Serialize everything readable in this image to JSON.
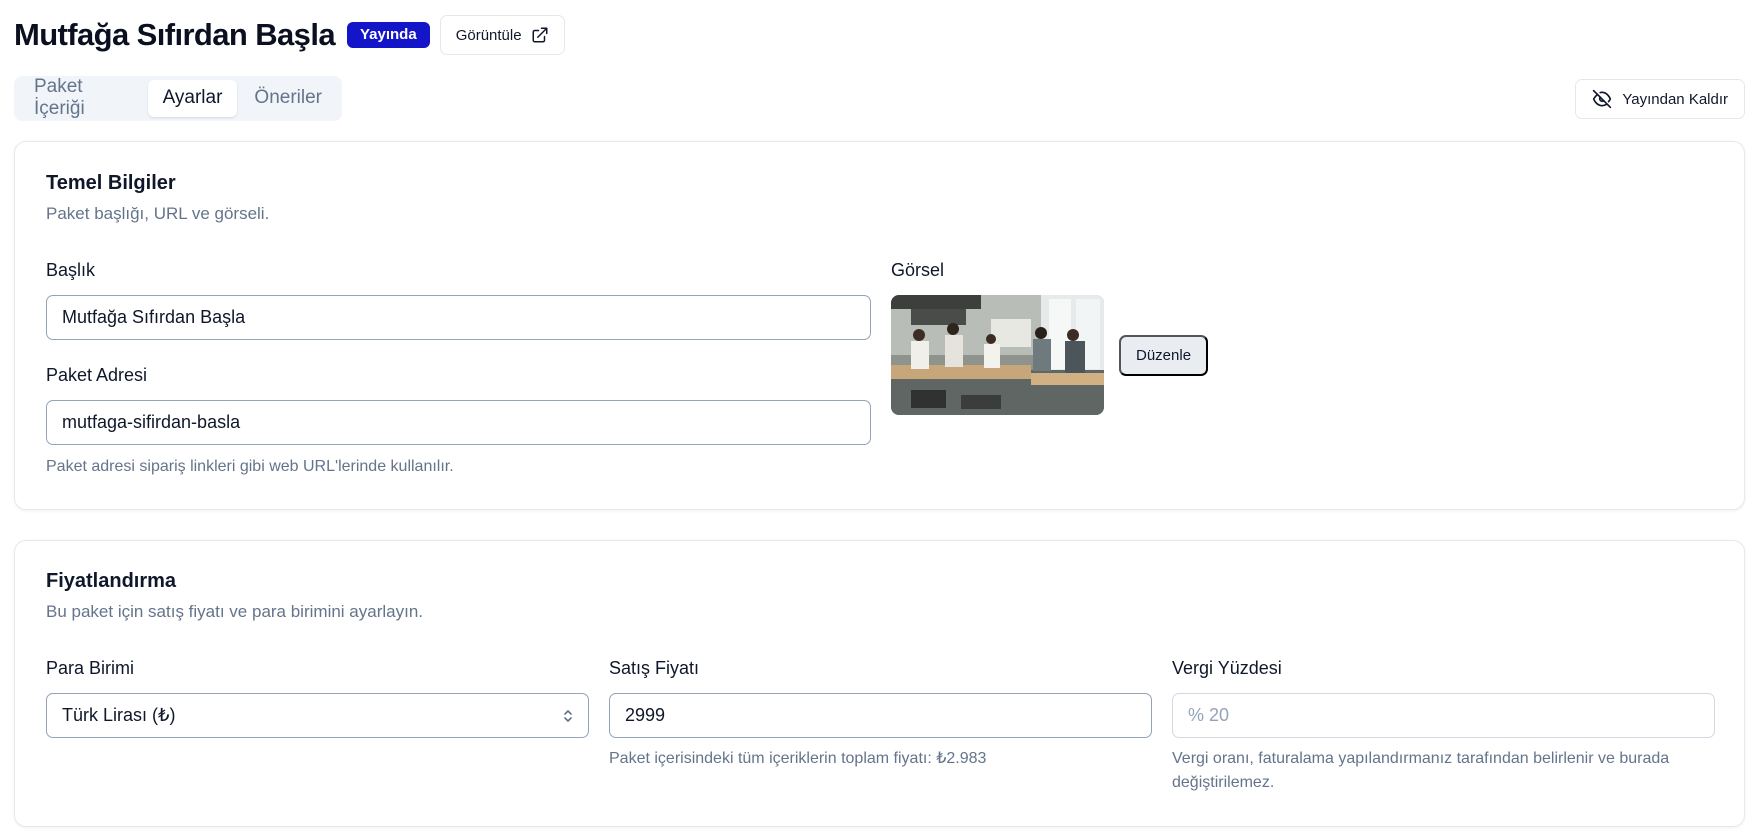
{
  "header": {
    "title": "Mutfağa Sıfırdan Başla",
    "status_badge": "Yayında",
    "view_button": "Görüntüle"
  },
  "tabs": [
    {
      "label": "Paket İçeriği",
      "active": false
    },
    {
      "label": "Ayarlar",
      "active": true
    },
    {
      "label": "Öneriler",
      "active": false
    }
  ],
  "unpublish_button": "Yayından Kaldır",
  "basic_info": {
    "title": "Temel Bilgiler",
    "description": "Paket başlığı, URL ve görseli.",
    "title_label": "Başlık",
    "title_value": "Mutfağa Sıfırdan Başla",
    "slug_label": "Paket Adresi",
    "slug_value": "mutfaga-sifirdan-basla",
    "slug_hint": "Paket adresi sipariş linkleri gibi web URL'lerinde kullanılır.",
    "image_label": "Görsel",
    "edit_button": "Düzenle"
  },
  "pricing": {
    "title": "Fiyatlandırma",
    "description": "Bu paket için satış fiyatı ve para birimini ayarlayın.",
    "currency_label": "Para Birimi",
    "currency_value": "Türk Lirası (₺)",
    "price_label": "Satış Fiyatı",
    "price_value": "2999",
    "price_hint": "Paket içerisindeki tüm içeriklerin toplam fiyatı: ₺2.983",
    "tax_label": "Vergi Yüzdesi",
    "tax_placeholder": "% 20",
    "tax_hint": "Vergi oranı, faturalama yapılandırmanız tarafından belirlenir ve burada değiştirilemez."
  },
  "colors": {
    "badge": "#1414c8",
    "muted_text": "#64748b",
    "border": "#e5e9ef"
  },
  "icons": {
    "view": "external-link-icon",
    "unpublish": "eye-off-icon",
    "select": "chevron-up-down-icon"
  }
}
